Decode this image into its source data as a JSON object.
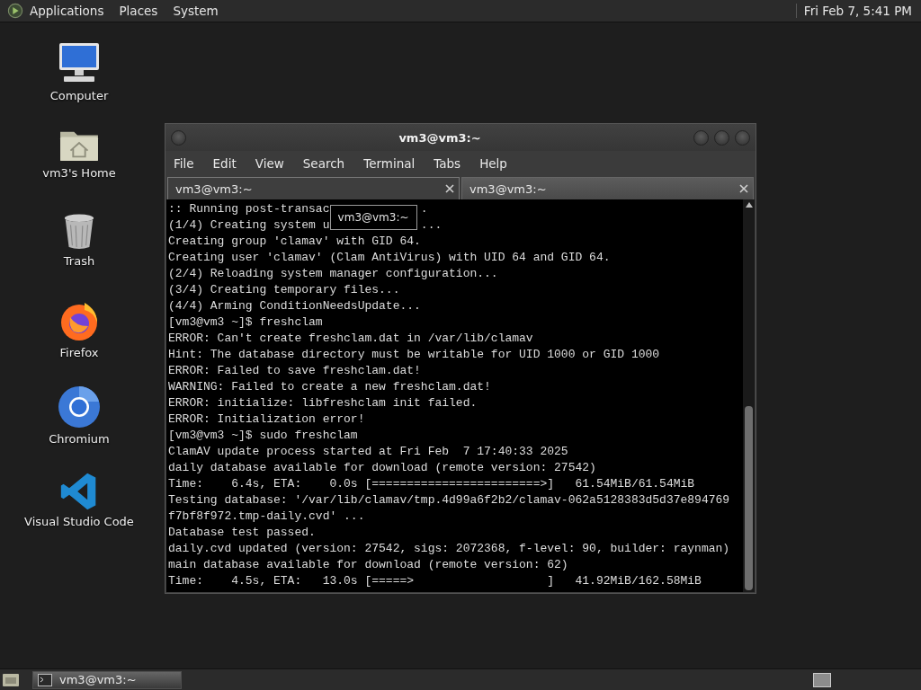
{
  "top_panel": {
    "menus": [
      "Applications",
      "Places",
      "System"
    ],
    "clock": "Fri Feb 7, 5:41 PM"
  },
  "desktop_icons": [
    {
      "label": "Computer",
      "kind": "computer"
    },
    {
      "label": "vm3's Home",
      "kind": "home"
    },
    {
      "label": "Trash",
      "kind": "trash"
    },
    {
      "label": "Firefox",
      "kind": "firefox"
    },
    {
      "label": "Chromium",
      "kind": "chromium"
    },
    {
      "label": "Visual Studio Code",
      "kind": "vscode"
    }
  ],
  "terminal_window": {
    "title": "vm3@vm3:~",
    "menu": [
      "File",
      "Edit",
      "View",
      "Search",
      "Terminal",
      "Tabs",
      "Help"
    ],
    "tabs": [
      {
        "label": "vm3@vm3:~",
        "selected": true
      },
      {
        "label": "vm3@vm3:~",
        "selected": false
      }
    ],
    "tooltip": "vm3@vm3:~",
    "lines": [
      {
        "text": ":: Running post-transac",
        "after": "."
      },
      {
        "text": "(1/4) Creating system u",
        "after": "..."
      },
      {
        "text": "Creating group 'clamav' with GID 64."
      },
      {
        "text": "Creating user 'clamav' (Clam AntiVirus) with UID 64 and GID 64."
      },
      {
        "text": "(2/4) Reloading system manager configuration..."
      },
      {
        "text": "(3/4) Creating temporary files..."
      },
      {
        "text": "(4/4) Arming ConditionNeedsUpdate..."
      },
      {
        "text": "[vm3@vm3 ~]$ freshclam"
      },
      {
        "text": "ERROR: Can't create freshclam.dat in /var/lib/clamav"
      },
      {
        "text": "Hint: The database directory must be writable for UID 1000 or GID 1000"
      },
      {
        "text": "ERROR: Failed to save freshclam.dat!"
      },
      {
        "text": "WARNING: Failed to create a new freshclam.dat!"
      },
      {
        "text": "ERROR: initialize: libfreshclam init failed."
      },
      {
        "text": "ERROR: Initialization error!"
      },
      {
        "text": "[vm3@vm3 ~]$ sudo freshclam"
      },
      {
        "text": "ClamAV update process started at Fri Feb  7 17:40:33 2025"
      },
      {
        "text": "daily database available for download (remote version: 27542)"
      },
      {
        "text": "Time:    6.4s, ETA:    0.0s [========================>]   61.54MiB/61.54MiB"
      },
      {
        "text": "Testing database: '/var/lib/clamav/tmp.4d99a6f2b2/clamav-062a5128383d5d37e894769"
      },
      {
        "text": "f7bf8f972.tmp-daily.cvd' ..."
      },
      {
        "text": "Database test passed."
      },
      {
        "text": "daily.cvd updated (version: 27542, sigs: 2072368, f-level: 90, builder: raynman)"
      },
      {
        "text": "main database available for download (remote version: 62)"
      },
      {
        "text": "Time:    4.5s, ETA:   13.0s [=====>                   ]   41.92MiB/162.58MiB"
      }
    ]
  },
  "taskbar": {
    "tasks": [
      {
        "label": "vm3@vm3:~",
        "selected": true
      }
    ]
  }
}
